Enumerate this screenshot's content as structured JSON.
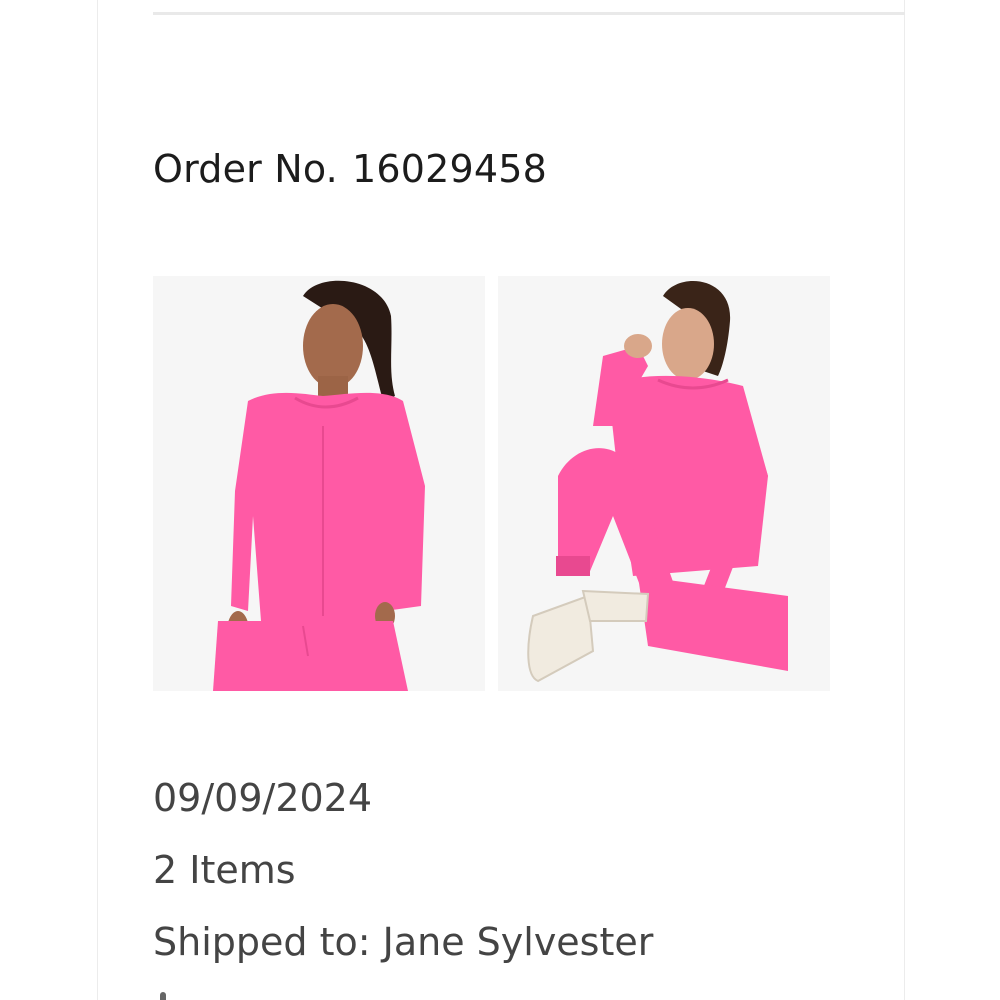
{
  "order": {
    "label": "Order No.",
    "number": "16029458",
    "date": "09/09/2024",
    "items_count": "2 Items",
    "shipped_to": "Shipped to: Jane Sylvester"
  },
  "images": [
    {
      "name": "product-image-top",
      "icon": "pink-long-sleeve-top-photo"
    },
    {
      "name": "product-image-set",
      "icon": "pink-top-and-jogger-photo"
    }
  ],
  "colors": {
    "garment_pink": "#ff5aa5",
    "text_dark": "#1c1c1c",
    "text_meta": "#444444",
    "divider": "#e9e9e9"
  }
}
